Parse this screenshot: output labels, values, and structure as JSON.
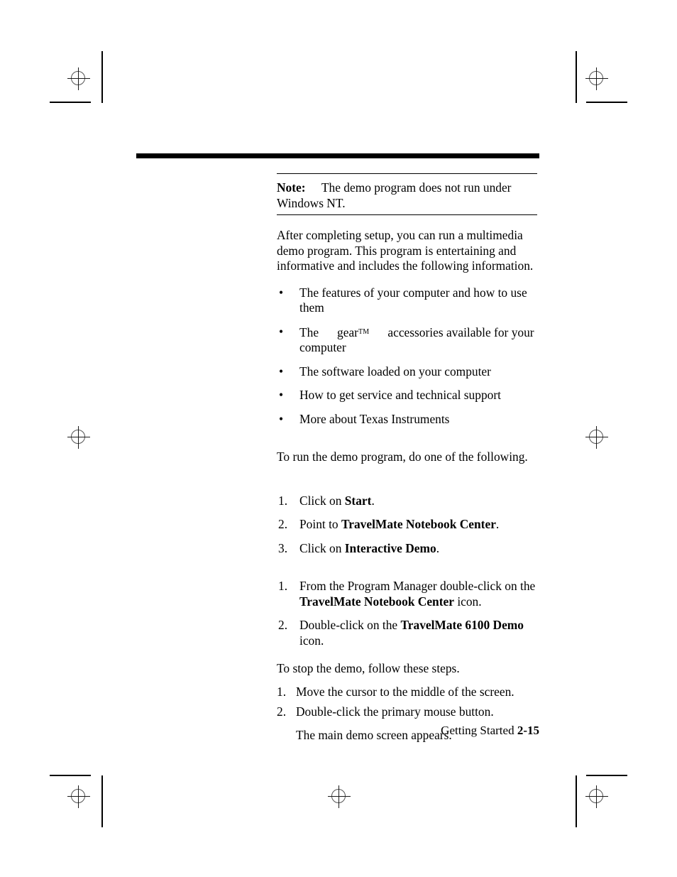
{
  "page": {
    "footer_label": "Getting Started",
    "page_number": "2-15"
  },
  "note": {
    "label": "Note:",
    "text": "The demo program does not run under Windows NT."
  },
  "intro": {
    "paragraph": "After completing setup, you can run a multimedia demo program. This program is entertaining and informative and includes the following information."
  },
  "features": {
    "bullet_glyph": "•",
    "items": [
      {
        "text": "The features of your computer and how to use them"
      },
      {
        "pre": "The",
        "brand": "gear",
        "tm": "TM",
        "post": "accessories available for your computer"
      },
      {
        "text": "The software loaded on your computer"
      },
      {
        "text": "How to get service and technical support"
      },
      {
        "text": "More about Texas Instruments"
      }
    ]
  },
  "run_demo": {
    "lead": "To run the demo program, do one of the following.",
    "steps_windows95": [
      {
        "num": "1.",
        "pre": "Click on ",
        "bold": "Start",
        "post": "."
      },
      {
        "num": "2.",
        "pre": "Point to ",
        "bold": "TravelMate Notebook Center",
        "post": "."
      },
      {
        "num": "3.",
        "pre": "Click on ",
        "bold": "Interactive Demo",
        "post": "."
      }
    ],
    "steps_windows31": [
      {
        "num": "1.",
        "pre": "From the Program Manager double-click on the ",
        "bold": "TravelMate Notebook Center",
        "post": " icon."
      },
      {
        "num": "2.",
        "pre": "Double-click on the ",
        "bold": "TravelMate 6100 Demo",
        "post": " icon."
      }
    ]
  },
  "stop_demo": {
    "lead": "To stop the demo, follow these steps.",
    "steps": [
      {
        "num": "1.",
        "text": "Move the cursor to the middle of the screen."
      },
      {
        "num": "2.",
        "text": "Double-click the primary mouse button."
      }
    ],
    "result": "The main demo screen appears."
  }
}
